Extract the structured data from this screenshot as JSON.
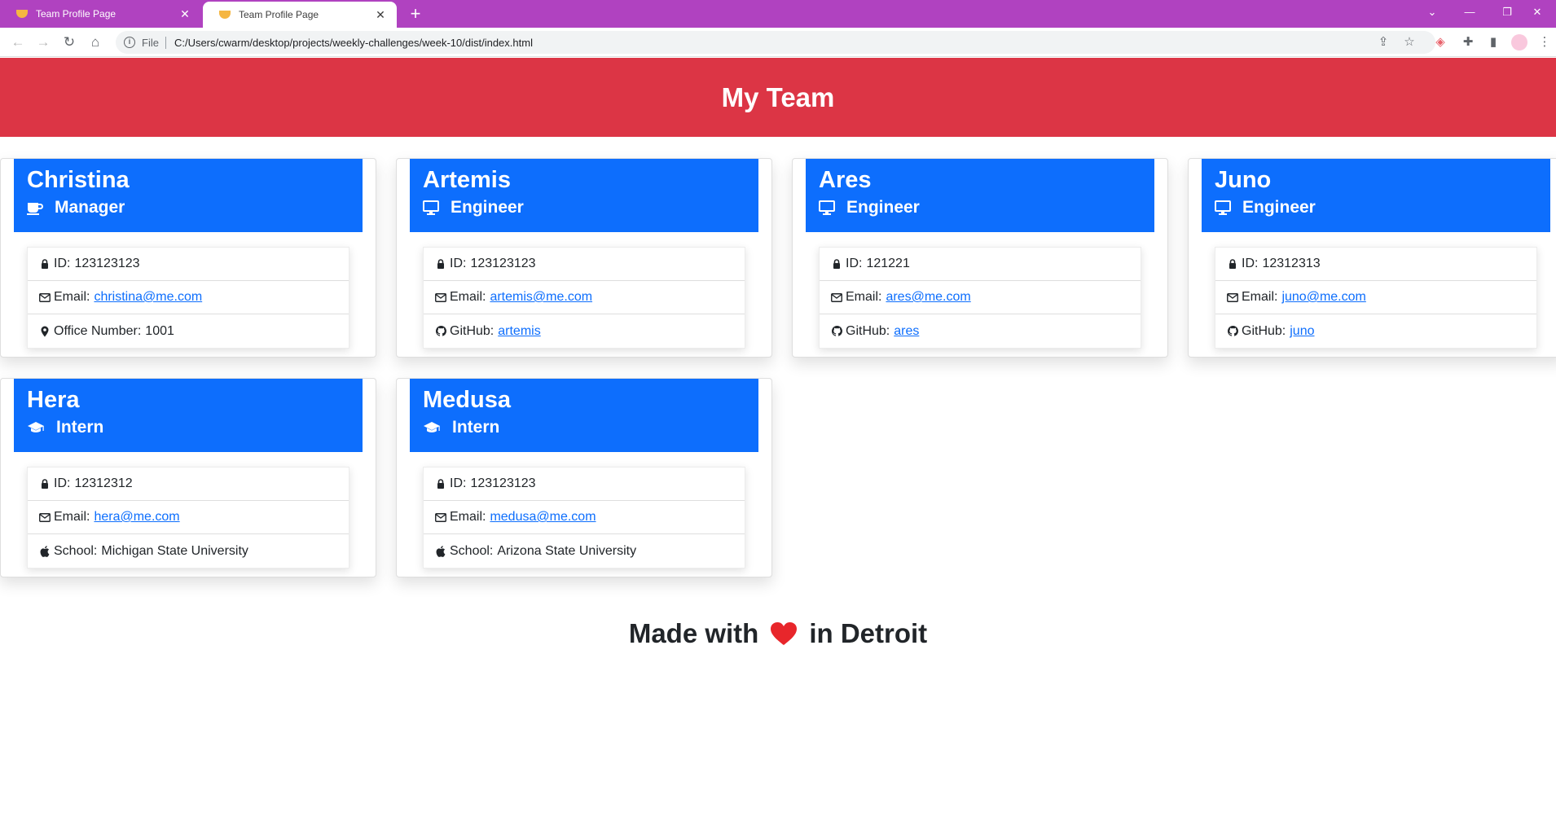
{
  "browser": {
    "tabs": [
      {
        "title": "Team Profile Page",
        "active": false
      },
      {
        "title": "Team Profile Page",
        "active": true
      }
    ],
    "url_scheme": "File",
    "url": "C:/Users/cwarm/desktop/projects/weekly-challenges/week-10/dist/index.html"
  },
  "page": {
    "title": "My Team",
    "footer_before": "Made with",
    "footer_after": "in Detroit"
  },
  "team": [
    {
      "name": "Christina",
      "role": "Manager",
      "role_icon": "mug-icon",
      "id_label": "ID:",
      "id": "123123123",
      "email_label": "Email:",
      "email": "christina@me.com",
      "extra_label": "Office Number:",
      "extra": "1001",
      "extra_icon": "map-pin-icon",
      "extra_link": false
    },
    {
      "name": "Artemis",
      "role": "Engineer",
      "role_icon": "desktop-icon",
      "id_label": "ID:",
      "id": "123123123",
      "email_label": "Email:",
      "email": "artemis@me.com",
      "extra_label": "GitHub:",
      "extra": "artemis",
      "extra_icon": "github-icon",
      "extra_link": true
    },
    {
      "name": "Ares",
      "role": "Engineer",
      "role_icon": "desktop-icon",
      "id_label": "ID:",
      "id": "121221",
      "email_label": "Email:",
      "email": "ares@me.com",
      "extra_label": "GitHub:",
      "extra": "ares",
      "extra_icon": "github-icon",
      "extra_link": true
    },
    {
      "name": "Juno",
      "role": "Engineer",
      "role_icon": "desktop-icon",
      "id_label": "ID:",
      "id": "12312313",
      "email_label": "Email:",
      "email": "juno@me.com",
      "extra_label": "GitHub:",
      "extra": "juno",
      "extra_icon": "github-icon",
      "extra_link": true
    },
    {
      "name": "Hera",
      "role": "Intern",
      "role_icon": "graduation-cap-icon",
      "id_label": "ID:",
      "id": "12312312",
      "email_label": "Email:",
      "email": "hera@me.com",
      "extra_label": "School:",
      "extra": "Michigan State University",
      "extra_icon": "apple-icon",
      "extra_link": false
    },
    {
      "name": "Medusa",
      "role": "Intern",
      "role_icon": "graduation-cap-icon",
      "id_label": "ID:",
      "id": "123123123",
      "email_label": "Email:",
      "email": "medusa@me.com",
      "extra_label": "School:",
      "extra": "Arizona State University",
      "extra_icon": "apple-icon",
      "extra_link": false
    }
  ],
  "colors": {
    "tabstrip": "#b042c0",
    "hero": "#dc3545",
    "card_header": "#0d6efd",
    "link": "#0d6efd",
    "heart": "#e8262b"
  }
}
